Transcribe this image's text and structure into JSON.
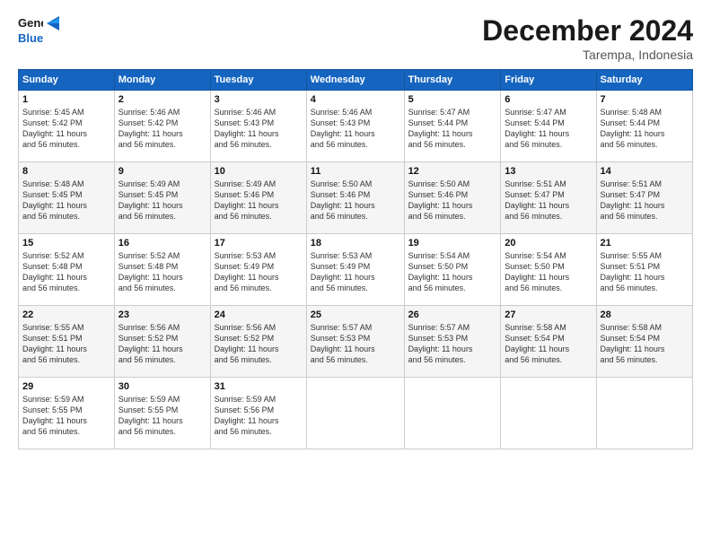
{
  "logo": {
    "line1": "General",
    "line2": "Blue"
  },
  "title": "December 2024",
  "subtitle": "Tarempa, Indonesia",
  "days_header": [
    "Sunday",
    "Monday",
    "Tuesday",
    "Wednesday",
    "Thursday",
    "Friday",
    "Saturday"
  ],
  "weeks": [
    [
      {
        "day": "1",
        "detail": "Sunrise: 5:45 AM\nSunset: 5:42 PM\nDaylight: 11 hours\nand 56 minutes."
      },
      {
        "day": "2",
        "detail": "Sunrise: 5:46 AM\nSunset: 5:42 PM\nDaylight: 11 hours\nand 56 minutes."
      },
      {
        "day": "3",
        "detail": "Sunrise: 5:46 AM\nSunset: 5:43 PM\nDaylight: 11 hours\nand 56 minutes."
      },
      {
        "day": "4",
        "detail": "Sunrise: 5:46 AM\nSunset: 5:43 PM\nDaylight: 11 hours\nand 56 minutes."
      },
      {
        "day": "5",
        "detail": "Sunrise: 5:47 AM\nSunset: 5:44 PM\nDaylight: 11 hours\nand 56 minutes."
      },
      {
        "day": "6",
        "detail": "Sunrise: 5:47 AM\nSunset: 5:44 PM\nDaylight: 11 hours\nand 56 minutes."
      },
      {
        "day": "7",
        "detail": "Sunrise: 5:48 AM\nSunset: 5:44 PM\nDaylight: 11 hours\nand 56 minutes."
      }
    ],
    [
      {
        "day": "8",
        "detail": "Sunrise: 5:48 AM\nSunset: 5:45 PM\nDaylight: 11 hours\nand 56 minutes."
      },
      {
        "day": "9",
        "detail": "Sunrise: 5:49 AM\nSunset: 5:45 PM\nDaylight: 11 hours\nand 56 minutes."
      },
      {
        "day": "10",
        "detail": "Sunrise: 5:49 AM\nSunset: 5:46 PM\nDaylight: 11 hours\nand 56 minutes."
      },
      {
        "day": "11",
        "detail": "Sunrise: 5:50 AM\nSunset: 5:46 PM\nDaylight: 11 hours\nand 56 minutes."
      },
      {
        "day": "12",
        "detail": "Sunrise: 5:50 AM\nSunset: 5:46 PM\nDaylight: 11 hours\nand 56 minutes."
      },
      {
        "day": "13",
        "detail": "Sunrise: 5:51 AM\nSunset: 5:47 PM\nDaylight: 11 hours\nand 56 minutes."
      },
      {
        "day": "14",
        "detail": "Sunrise: 5:51 AM\nSunset: 5:47 PM\nDaylight: 11 hours\nand 56 minutes."
      }
    ],
    [
      {
        "day": "15",
        "detail": "Sunrise: 5:52 AM\nSunset: 5:48 PM\nDaylight: 11 hours\nand 56 minutes."
      },
      {
        "day": "16",
        "detail": "Sunrise: 5:52 AM\nSunset: 5:48 PM\nDaylight: 11 hours\nand 56 minutes."
      },
      {
        "day": "17",
        "detail": "Sunrise: 5:53 AM\nSunset: 5:49 PM\nDaylight: 11 hours\nand 56 minutes."
      },
      {
        "day": "18",
        "detail": "Sunrise: 5:53 AM\nSunset: 5:49 PM\nDaylight: 11 hours\nand 56 minutes."
      },
      {
        "day": "19",
        "detail": "Sunrise: 5:54 AM\nSunset: 5:50 PM\nDaylight: 11 hours\nand 56 minutes."
      },
      {
        "day": "20",
        "detail": "Sunrise: 5:54 AM\nSunset: 5:50 PM\nDaylight: 11 hours\nand 56 minutes."
      },
      {
        "day": "21",
        "detail": "Sunrise: 5:55 AM\nSunset: 5:51 PM\nDaylight: 11 hours\nand 56 minutes."
      }
    ],
    [
      {
        "day": "22",
        "detail": "Sunrise: 5:55 AM\nSunset: 5:51 PM\nDaylight: 11 hours\nand 56 minutes."
      },
      {
        "day": "23",
        "detail": "Sunrise: 5:56 AM\nSunset: 5:52 PM\nDaylight: 11 hours\nand 56 minutes."
      },
      {
        "day": "24",
        "detail": "Sunrise: 5:56 AM\nSunset: 5:52 PM\nDaylight: 11 hours\nand 56 minutes."
      },
      {
        "day": "25",
        "detail": "Sunrise: 5:57 AM\nSunset: 5:53 PM\nDaylight: 11 hours\nand 56 minutes."
      },
      {
        "day": "26",
        "detail": "Sunrise: 5:57 AM\nSunset: 5:53 PM\nDaylight: 11 hours\nand 56 minutes."
      },
      {
        "day": "27",
        "detail": "Sunrise: 5:58 AM\nSunset: 5:54 PM\nDaylight: 11 hours\nand 56 minutes."
      },
      {
        "day": "28",
        "detail": "Sunrise: 5:58 AM\nSunset: 5:54 PM\nDaylight: 11 hours\nand 56 minutes."
      }
    ],
    [
      {
        "day": "29",
        "detail": "Sunrise: 5:59 AM\nSunset: 5:55 PM\nDaylight: 11 hours\nand 56 minutes."
      },
      {
        "day": "30",
        "detail": "Sunrise: 5:59 AM\nSunset: 5:55 PM\nDaylight: 11 hours\nand 56 minutes."
      },
      {
        "day": "31",
        "detail": "Sunrise: 5:59 AM\nSunset: 5:56 PM\nDaylight: 11 hours\nand 56 minutes."
      },
      null,
      null,
      null,
      null
    ]
  ]
}
